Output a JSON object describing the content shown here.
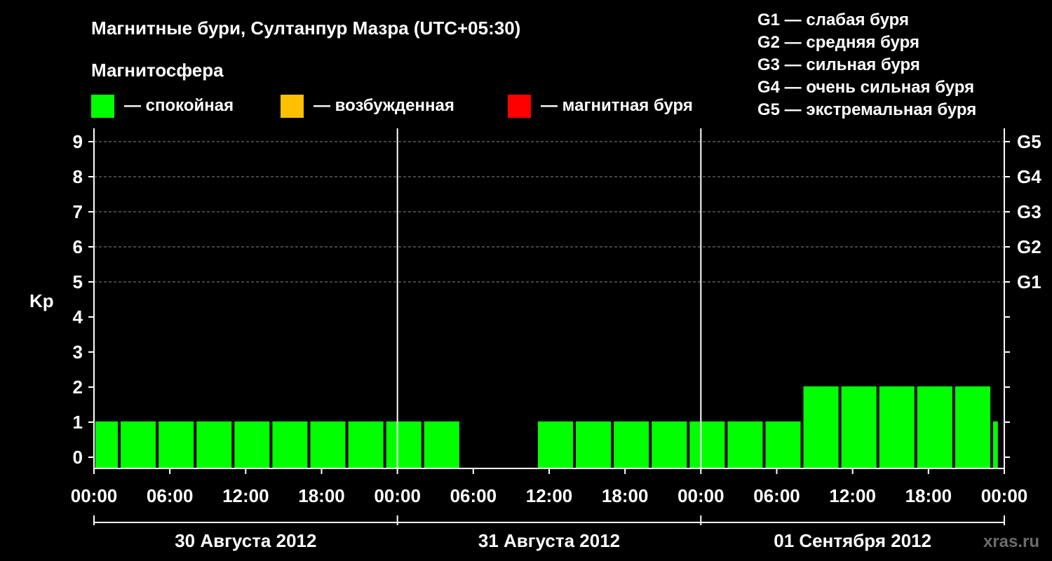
{
  "chart_data": {
    "type": "bar",
    "title": "Магнитные бури, Султанпур Мазра (UTC+05:30)",
    "subtitle": "Магнитосфера",
    "ylabel": "Kp",
    "ylim": [
      0,
      9
    ],
    "yticks": [
      "0",
      "1",
      "2",
      "3",
      "4",
      "5",
      "6",
      "7",
      "8",
      "9"
    ],
    "right_ticks": [
      {
        "value": 5,
        "label": "G1"
      },
      {
        "value": 6,
        "label": "G2"
      },
      {
        "value": 7,
        "label": "G3"
      },
      {
        "value": 8,
        "label": "G4"
      },
      {
        "value": 9,
        "label": "G5"
      }
    ],
    "xlim_hours": [
      0,
      72
    ],
    "xticks": [
      {
        "hour": 0,
        "label": "00:00"
      },
      {
        "hour": 6,
        "label": "06:00"
      },
      {
        "hour": 12,
        "label": "12:00"
      },
      {
        "hour": 18,
        "label": "18:00"
      },
      {
        "hour": 24,
        "label": "00:00"
      },
      {
        "hour": 30,
        "label": "06:00"
      },
      {
        "hour": 36,
        "label": "12:00"
      },
      {
        "hour": 42,
        "label": "18:00"
      },
      {
        "hour": 48,
        "label": "00:00"
      },
      {
        "hour": 54,
        "label": "06:00"
      },
      {
        "hour": 60,
        "label": "12:00"
      },
      {
        "hour": 66,
        "label": "18:00"
      },
      {
        "hour": 72,
        "label": "00:00"
      }
    ],
    "days": [
      {
        "label": "30 Августа 2012",
        "start": 0,
        "end": 24
      },
      {
        "label": "31 Августа 2012",
        "start": 24,
        "end": 48
      },
      {
        "label": "01 Сентября 2012",
        "start": 48,
        "end": 72
      }
    ],
    "bars": [
      {
        "start": 0,
        "end": 2,
        "value": 1
      },
      {
        "start": 2,
        "end": 5,
        "value": 1
      },
      {
        "start": 5,
        "end": 8,
        "value": 1
      },
      {
        "start": 8,
        "end": 11,
        "value": 1
      },
      {
        "start": 11,
        "end": 14,
        "value": 1
      },
      {
        "start": 14,
        "end": 17,
        "value": 1
      },
      {
        "start": 17,
        "end": 20,
        "value": 1
      },
      {
        "start": 20,
        "end": 23,
        "value": 1
      },
      {
        "start": 23,
        "end": 26,
        "value": 1
      },
      {
        "start": 26,
        "end": 29,
        "value": 1
      },
      {
        "start": 35,
        "end": 38,
        "value": 1
      },
      {
        "start": 38,
        "end": 41,
        "value": 1
      },
      {
        "start": 41,
        "end": 44,
        "value": 1
      },
      {
        "start": 44,
        "end": 47,
        "value": 1
      },
      {
        "start": 47,
        "end": 50,
        "value": 1
      },
      {
        "start": 50,
        "end": 53,
        "value": 1
      },
      {
        "start": 53,
        "end": 56,
        "value": 1
      },
      {
        "start": 56,
        "end": 59,
        "value": 2
      },
      {
        "start": 59,
        "end": 62,
        "value": 2
      },
      {
        "start": 62,
        "end": 65,
        "value": 2
      },
      {
        "start": 65,
        "end": 68,
        "value": 2
      },
      {
        "start": 68,
        "end": 71,
        "value": 2
      },
      {
        "start": 71,
        "end": 71.6,
        "value": 1
      }
    ],
    "legend": [
      {
        "label": "— спокойная",
        "color": "#00ff00"
      },
      {
        "label": "— возбужденная",
        "color": "#ffc000"
      },
      {
        "label": "— магнитная буря",
        "color": "#ff0000"
      }
    ],
    "storm_scale": [
      "G1 — слабая буря",
      "G2 — средняя буря",
      "G3 — сильная буря",
      "G4 — очень сильная буря",
      "G5 — экстремальная буря"
    ],
    "grid": true
  },
  "watermark": "xras.ru",
  "colors": {
    "background": "#000000",
    "axis": "#ffffff",
    "grid": "#888888",
    "bar_quiet": "#00ff00"
  }
}
